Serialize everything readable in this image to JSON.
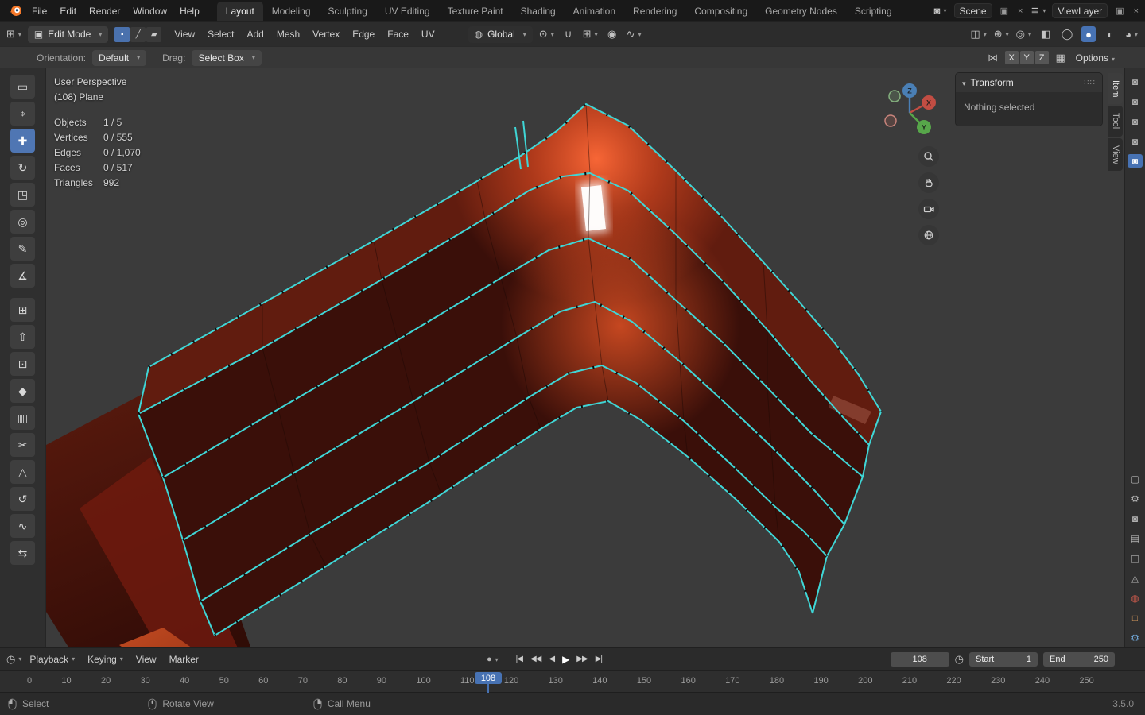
{
  "colors": {
    "accent": "#4772b3",
    "edge_highlight": "#3fd6d6",
    "mesh_glow": "#ff6a38",
    "mesh_base": "#3a0f09"
  },
  "topbar": {
    "menus": [
      "File",
      "Edit",
      "Render",
      "Window",
      "Help"
    ],
    "workspaces": [
      {
        "label": "Layout",
        "active": true
      },
      {
        "label": "Modeling"
      },
      {
        "label": "Sculpting"
      },
      {
        "label": "UV Editing"
      },
      {
        "label": "Texture Paint"
      },
      {
        "label": "Shading"
      },
      {
        "label": "Animation"
      },
      {
        "label": "Rendering"
      },
      {
        "label": "Compositing"
      },
      {
        "label": "Geometry Nodes"
      },
      {
        "label": "Scripting"
      }
    ],
    "scene_label": "Scene",
    "viewlayer_label": "ViewLayer",
    "scene_icon": "◙",
    "viewlayer_icon": "≣",
    "new_icon": "▣",
    "close_icon": "×"
  },
  "viewport_header": {
    "editor_glyph": "⊞",
    "mode": "Edit Mode",
    "mode_icon": "▣",
    "select_modes": [
      {
        "name": "vertex-select-mode",
        "glyph": "▪",
        "active": true
      },
      {
        "name": "edge-select-mode",
        "glyph": "╱"
      },
      {
        "name": "face-select-mode",
        "glyph": "▰"
      }
    ],
    "menus": [
      "View",
      "Select",
      "Add",
      "Mesh",
      "Vertex",
      "Edge",
      "Face",
      "UV"
    ],
    "orientation_icon": "◍",
    "orientation": "Global",
    "mid_icons": [
      {
        "name": "transform-pivot-icon",
        "glyph": "⊙",
        "caret": true
      },
      {
        "name": "snap-magnet-icon",
        "glyph": "∪"
      },
      {
        "name": "snap-target-icon",
        "glyph": "⊞",
        "caret": true
      },
      {
        "name": "proportional-editing-icon",
        "glyph": "◉"
      },
      {
        "name": "falloff-icon",
        "glyph": "∿",
        "caret": true
      }
    ],
    "right_icons": [
      {
        "name": "show-object-types-icon",
        "glyph": "◫",
        "caret": true
      },
      {
        "name": "show-gizmo-icon",
        "glyph": "⊕",
        "caret": true
      },
      {
        "name": "show-overlays-icon",
        "glyph": "◎",
        "caret": true
      },
      {
        "name": "toggle-xray-icon",
        "glyph": "◧"
      },
      {
        "name": "shading-wireframe-icon",
        "glyph": "◯"
      },
      {
        "name": "shading-solid-icon",
        "glyph": "●",
        "active": true
      },
      {
        "name": "shading-material-icon",
        "glyph": "◐"
      },
      {
        "name": "shading-rendered-icon",
        "glyph": "◕",
        "caret": true
      }
    ]
  },
  "tool_settings": {
    "orientation_label": "Orientation:",
    "orientation_value": "Default",
    "drag_label": "Drag:",
    "drag_value": "Select Box",
    "mirror_glyph": "⋈",
    "axes": [
      "X",
      "Y",
      "Z"
    ],
    "snap_base_glyph": "▦",
    "options_label": "Options"
  },
  "tools": [
    {
      "name": "tweak-select-tool",
      "glyph": "▭"
    },
    {
      "name": "cursor-tool",
      "glyph": "⌖"
    },
    {
      "name": "move-tool",
      "glyph": "✚",
      "active": true
    },
    {
      "name": "rotate-tool",
      "glyph": "↻"
    },
    {
      "name": "scale-tool",
      "glyph": "◳"
    },
    {
      "name": "transform-tool",
      "glyph": "◎"
    },
    {
      "name": "annotate-tool",
      "glyph": "✎"
    },
    {
      "name": "measure-tool",
      "glyph": "∡"
    },
    {
      "name": "add-cube-tool",
      "glyph": "⊞"
    },
    {
      "name": "extrude-region-tool",
      "glyph": "⇧"
    },
    {
      "name": "inset-faces-tool",
      "glyph": "⊡"
    },
    {
      "name": "bevel-tool",
      "glyph": "◆"
    },
    {
      "name": "loop-cut-tool",
      "glyph": "▥"
    },
    {
      "name": "knife-tool",
      "glyph": "✂"
    },
    {
      "name": "poly-build-tool",
      "glyph": "△"
    },
    {
      "name": "spin-tool",
      "glyph": "↺"
    },
    {
      "name": "smooth-tool",
      "glyph": "∿"
    },
    {
      "name": "edge-slide-tool",
      "glyph": "⇆"
    }
  ],
  "viewport": {
    "view_label": "User Perspective",
    "object_label": "(108) Plane",
    "stats": [
      {
        "label": "Objects",
        "value": "1 / 5"
      },
      {
        "label": "Vertices",
        "value": "0 / 555"
      },
      {
        "label": "Edges",
        "value": "0 / 1,070"
      },
      {
        "label": "Faces",
        "value": "0 / 517"
      },
      {
        "label": "Triangles",
        "value": "992"
      }
    ],
    "gizmo": {
      "z": "Z",
      "x": "X",
      "y": "Y"
    }
  },
  "sidebar": {
    "tabs": [
      {
        "label": "Item",
        "active": true
      },
      {
        "label": "Tool"
      },
      {
        "label": "View"
      }
    ],
    "panel_title": "Transform",
    "empty_text": "Nothing selected"
  },
  "rail": {
    "top_icons": [
      {
        "name": "restrict-render-icon-1",
        "glyph": "◙"
      },
      {
        "name": "restrict-render-icon-2",
        "glyph": "◙"
      },
      {
        "name": "restrict-render-icon-3",
        "glyph": "◙"
      },
      {
        "name": "restrict-render-icon-4",
        "glyph": "◙"
      },
      {
        "name": "restrict-render-icon-5",
        "glyph": "◙",
        "active": true
      }
    ],
    "bottom_icons": [
      {
        "name": "editor-screen-icon",
        "glyph": "▢"
      },
      {
        "name": "active-tool-icon",
        "glyph": "⚙"
      },
      {
        "name": "render-properties-icon",
        "glyph": "◙"
      },
      {
        "name": "output-properties-icon",
        "glyph": "▤"
      },
      {
        "name": "view-layer-properties-icon",
        "glyph": "◫"
      },
      {
        "name": "scene-properties-icon",
        "glyph": "◬"
      },
      {
        "name": "world-properties-icon",
        "glyph": "◍",
        "color": "#c1574a"
      },
      {
        "name": "object-properties-icon",
        "glyph": "□",
        "color": "#d99a5b"
      },
      {
        "name": "modifier-properties-icon",
        "glyph": "⚙",
        "color": "#71a8d9"
      }
    ]
  },
  "timeline": {
    "editor_glyph": "◷",
    "menus": [
      {
        "name": "playback-menu",
        "label": "Playback",
        "caret": true
      },
      {
        "name": "keying-menu",
        "label": "Keying",
        "caret": true
      },
      {
        "name": "timeline-view-menu",
        "label": "View"
      },
      {
        "name": "marker-menu",
        "label": "Marker"
      }
    ],
    "record_glyph": "●",
    "transport": [
      {
        "name": "jump-to-start-button",
        "glyph": "|◀"
      },
      {
        "name": "prev-keyframe-button",
        "glyph": "◀◀"
      },
      {
        "name": "play-reverse-button",
        "glyph": "◀"
      },
      {
        "name": "play-button",
        "glyph": "▶"
      },
      {
        "name": "next-keyframe-button",
        "glyph": "▶▶"
      },
      {
        "name": "jump-to-end-button",
        "glyph": "▶|"
      }
    ],
    "frame": "108",
    "clock_glyph": "◷",
    "start_label": "Start",
    "start_value": "1",
    "end_label": "End",
    "end_value": "250",
    "ticks": [
      "0",
      "10",
      "20",
      "30",
      "40",
      "50",
      "60",
      "70",
      "80",
      "90",
      "100",
      "110",
      "120",
      "130",
      "140",
      "150",
      "160",
      "170",
      "180",
      "190",
      "200",
      "210",
      "220",
      "230",
      "240",
      "250"
    ]
  },
  "statusbar": {
    "hints": [
      {
        "label": "Select"
      },
      {
        "label": "Rotate View"
      },
      {
        "label": "Call Menu"
      }
    ],
    "version": "3.5.0"
  }
}
